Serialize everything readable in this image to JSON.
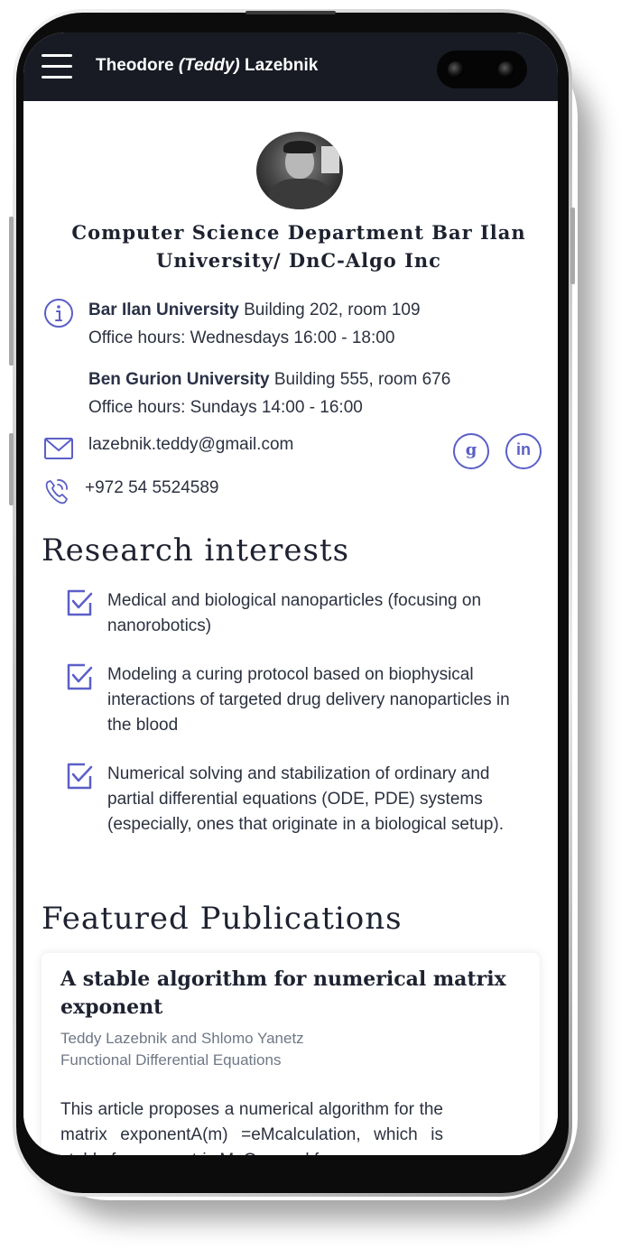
{
  "header": {
    "name_first": "Theodore",
    "nickname": "(Teddy)",
    "name_last": "Lazebnik"
  },
  "profile": {
    "department": "Computer Science Department Bar Ilan University/ DnC-Algo Inc"
  },
  "offices": [
    {
      "university": "Bar Ilan University",
      "location": " Building 202, room 109",
      "hours": "Office hours: Wednesdays 16:00 - 18:00"
    },
    {
      "university": "Ben Gurion University",
      "location": " Building 555, room 676",
      "hours": "Office hours: Sundays 14:00 - 16:00"
    }
  ],
  "contact": {
    "email": "lazebnik.teddy@gmail.com",
    "phone": "+972 54 5524589"
  },
  "social": {
    "google_label": "g",
    "linkedin_label": "in"
  },
  "research": {
    "title": "Research interests",
    "items": [
      "Medical and biological nanoparticles (focusing on nanorobotics)",
      "Modeling a curing protocol based on biophysical interactions of targeted drug delivery nanoparticles in the blood",
      "Numerical solving and stabilization of ordinary and partial differential equations (ODE, PDE) systems (especially, ones that originate in a biological setup)."
    ]
  },
  "publications": {
    "title": "Featured Publications",
    "items": [
      {
        "title": "A stable algorithm for numerical matrix exponent",
        "authors": "Teddy Lazebnik and Shlomo Yanetz",
        "journal": "Functional Differential Equations",
        "abstract": "This article proposes a numerical algorithm for the matrix exponentA(m) =eMcalculation, which is stable for any matrix M. Our goal for"
      }
    ]
  },
  "colors": {
    "header_bg": "#181b24",
    "accent": "#5b5fc7",
    "text": "#2c3140"
  }
}
